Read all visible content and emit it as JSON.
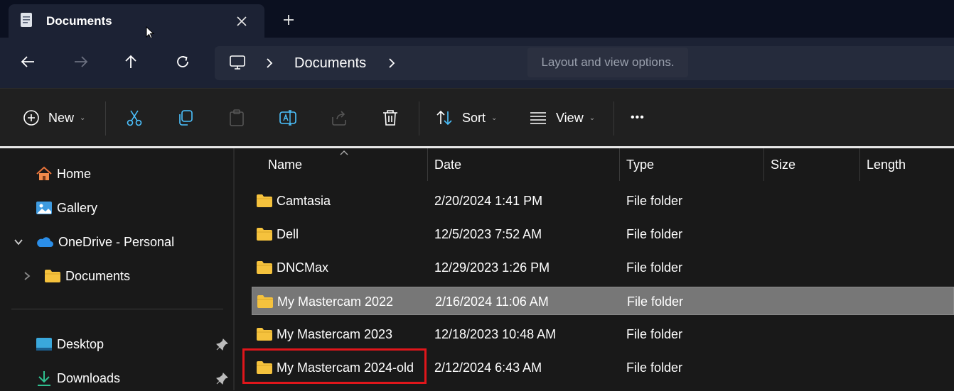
{
  "tab": {
    "title": "Documents",
    "close_glyph": "✕",
    "new_glyph": "+"
  },
  "nav": {
    "back_glyph": "←",
    "forward_glyph": "→",
    "up_glyph": "↑",
    "address": {
      "segment": "Documents"
    },
    "tooltip": "Layout and view options."
  },
  "commands": {
    "new_label": "New",
    "sort_label": "Sort",
    "view_label": "View",
    "more_glyph": "•••",
    "caret": "⌄"
  },
  "sidebar": {
    "home": "Home",
    "gallery": "Gallery",
    "onedrive": "OneDrive - Personal",
    "documents": "Documents",
    "desktop": "Desktop",
    "downloads": "Downloads"
  },
  "columns": {
    "name": "Name",
    "date": "Date",
    "type": "Type",
    "size": "Size",
    "length": "Length"
  },
  "files": [
    {
      "name": "Camtasia",
      "date": "2/20/2024 1:41 PM",
      "type": "File folder"
    },
    {
      "name": "Dell",
      "date": "12/5/2023 7:52 AM",
      "type": "File folder"
    },
    {
      "name": "DNCMax",
      "date": "12/29/2023 1:26 PM",
      "type": "File folder"
    },
    {
      "name": "My Mastercam 2022",
      "date": "2/16/2024 11:06 AM",
      "type": "File folder"
    },
    {
      "name": "My Mastercam 2023",
      "date": "12/18/2023 10:48 AM",
      "type": "File folder"
    },
    {
      "name": "My Mastercam 2024-old",
      "date": "2/12/2024 6:43 AM",
      "type": "File folder"
    }
  ],
  "colors": {
    "accent": "#4cc2ff",
    "folder": "#f5c23d",
    "highlight": "#e0161b",
    "selected_row": "#777777"
  }
}
